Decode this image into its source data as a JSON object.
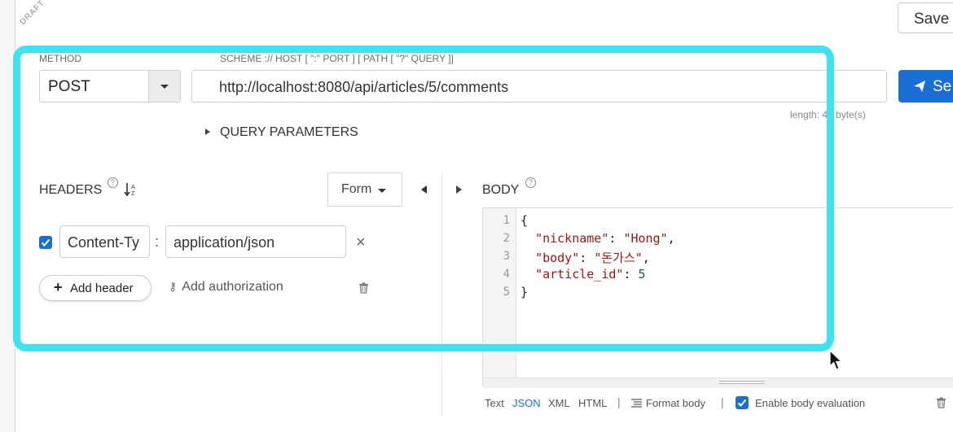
{
  "toolbar": {
    "draft_label": "DRAFT",
    "save_label": "Save",
    "send_label": "Se"
  },
  "request": {
    "method_label": "METHOD",
    "method_value": "POST",
    "scheme_label": "SCHEME :// HOST [ \":\" PORT ] [ PATH [ \"?\" QUERY ]]",
    "url": "http://localhost:8080/api/articles/5/comments",
    "length_text": "length: 45 byte(s)",
    "query_params_label": "QUERY PARAMETERS"
  },
  "headers": {
    "title": "HEADERS",
    "mode_label": "Form",
    "rows": [
      {
        "enabled": true,
        "name": "Content-Ty",
        "value": "application/json"
      }
    ],
    "separator": ":",
    "add_header_label": "Add header",
    "add_auth_label": "Add authorization"
  },
  "body": {
    "title": "BODY",
    "line_numbers": [
      "1",
      "2",
      "3",
      "4",
      "5"
    ],
    "code": {
      "open": "{",
      "nickname_key": "\"nickname\"",
      "nickname_val": "\"Hong\"",
      "body_key": "\"body\"",
      "body_val": "\"돈가스\"",
      "article_key": "\"article_id\"",
      "article_val": "5",
      "close": "}"
    },
    "formats": {
      "text": "Text",
      "json": "JSON",
      "xml": "XML",
      "html": "HTML",
      "active": "JSON"
    },
    "format_body_label": "Format body",
    "enable_eval_label": "Enable body evaluation",
    "enable_eval_checked": true
  },
  "colors": {
    "accent": "#1a6fd6",
    "highlight": "#3de3f0"
  },
  "icons": [
    "send-icon",
    "sort-icon",
    "help-icon",
    "key-icon",
    "trash-icon",
    "close-icon",
    "format-icon",
    "cursor-icon"
  ]
}
